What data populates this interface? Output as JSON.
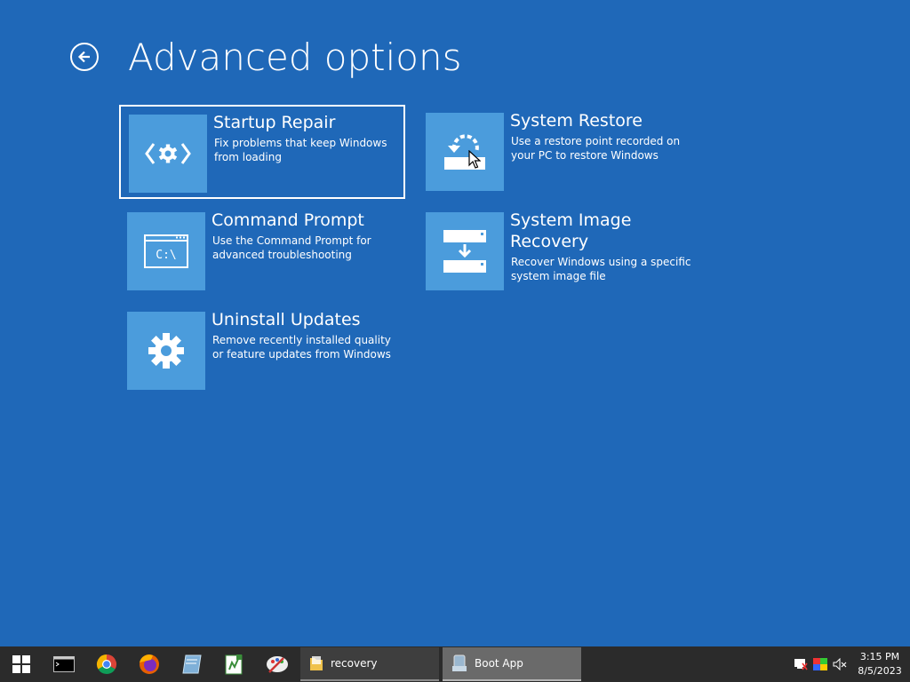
{
  "page": {
    "title": "Advanced options",
    "back_icon": "back-arrow-icon"
  },
  "options": [
    {
      "title": "Startup Repair",
      "description": "Fix problems that keep Windows from loading",
      "icon": "startup-repair-icon",
      "selected": true
    },
    {
      "title": "System Restore",
      "description": "Use a restore point recorded on your PC to restore Windows",
      "icon": "system-restore-icon"
    },
    {
      "title": "Command Prompt",
      "description": "Use the Command Prompt for advanced troubleshooting",
      "icon": "command-prompt-icon",
      "tile_text": "C:\\"
    },
    {
      "title": "System Image Recovery",
      "description": "Recover Windows using a specific system image file",
      "icon": "system-image-icon"
    },
    {
      "title": "Uninstall Updates",
      "description": "Remove recently installed quality or feature updates from Windows",
      "icon": "gear-icon"
    }
  ],
  "taskbar": {
    "pinned": [
      "start-icon",
      "cmd-icon",
      "chrome-icon",
      "firefox-icon",
      "notepad-icon",
      "editor-icon",
      "paint-icon"
    ],
    "windows": [
      {
        "label": "recovery",
        "icon": "folder-icon"
      },
      {
        "label": "Boot App",
        "icon": "boot-app-icon",
        "active": true
      }
    ],
    "tray": [
      "network-icon",
      "display-icon",
      "volume-muted-icon"
    ],
    "clock": {
      "time": "3:15 PM",
      "date": "8/5/2023"
    }
  },
  "colors": {
    "background": "#1f68b8",
    "tile": "#4b9cdc",
    "taskbar": "#2b2b2b"
  }
}
